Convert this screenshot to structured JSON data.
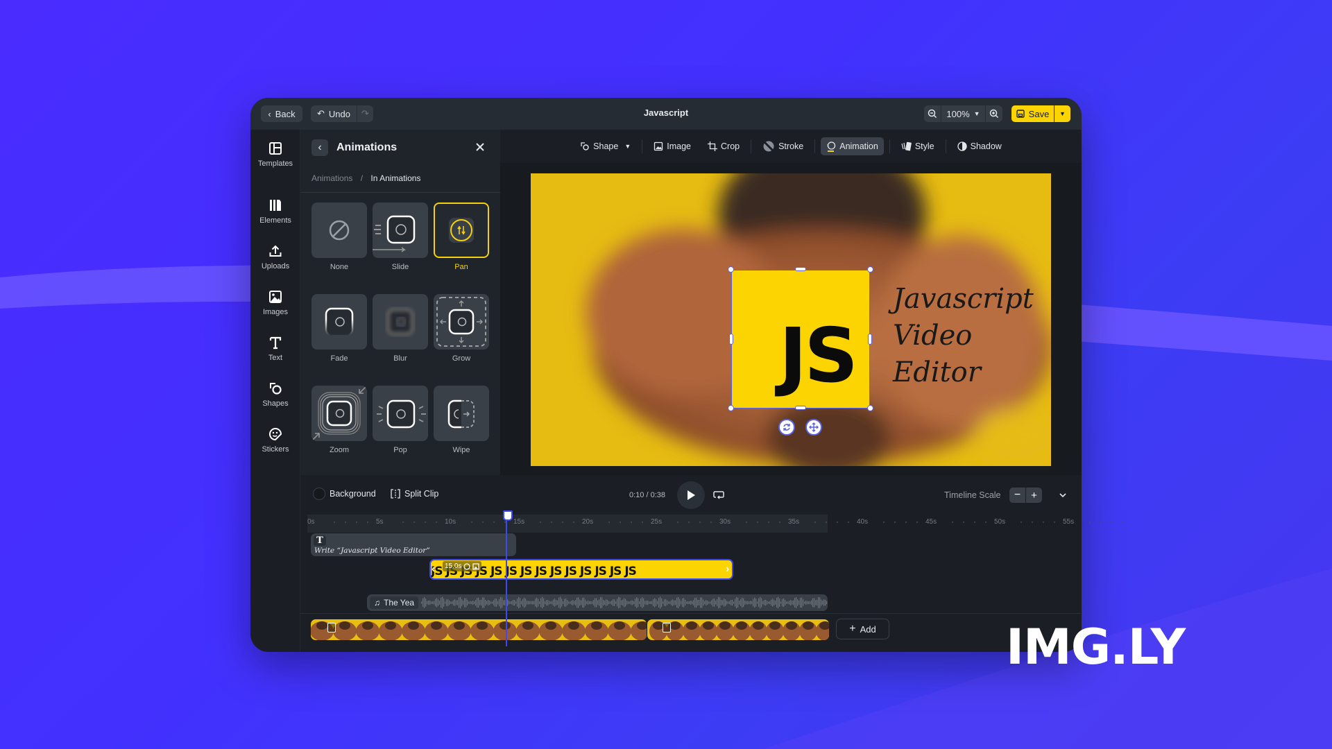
{
  "app": {
    "title": "Javascript",
    "back_label": "Back",
    "undo_label": "Undo",
    "zoom_level": "100%",
    "save_label": "Save"
  },
  "sidenav": [
    {
      "label": "Templates",
      "icon": "templates-icon"
    },
    {
      "label": "Elements",
      "icon": "elements-icon"
    },
    {
      "label": "Uploads",
      "icon": "upload-icon"
    },
    {
      "label": "Images",
      "icon": "image-icon"
    },
    {
      "label": "Text",
      "icon": "text-icon"
    },
    {
      "label": "Shapes",
      "icon": "shapes-icon"
    },
    {
      "label": "Stickers",
      "icon": "sticker-icon"
    }
  ],
  "panel": {
    "title": "Animations",
    "breadcrumb_root": "Animations",
    "breadcrumb_sep": "/",
    "breadcrumb_current": "In Animations",
    "animations": [
      {
        "label": "None",
        "selected": false
      },
      {
        "label": "Slide",
        "selected": false
      },
      {
        "label": "Pan",
        "selected": true
      },
      {
        "label": "Fade",
        "selected": false
      },
      {
        "label": "Blur",
        "selected": false
      },
      {
        "label": "Grow",
        "selected": false
      },
      {
        "label": "Zoom",
        "selected": false
      },
      {
        "label": "Pop",
        "selected": false
      },
      {
        "label": "Wipe",
        "selected": false
      }
    ]
  },
  "toolbar": {
    "items": [
      "Shape",
      "Image",
      "Crop",
      "Stroke",
      "Animation",
      "Style",
      "Shadow"
    ],
    "active": "Animation"
  },
  "canvas": {
    "logo_text": "JS",
    "caption_lines": [
      "Javascript",
      "Video",
      "Editor"
    ]
  },
  "timeline": {
    "background_label": "Background",
    "split_label": "Split Clip",
    "time_current": "0:10",
    "time_sep": "/",
    "time_total": "0:38",
    "scale_label": "Timeline Scale",
    "ticks": [
      "0s",
      "5s",
      "10s",
      "15s",
      "20s",
      "25s",
      "30s",
      "35s",
      "40s",
      "45s",
      "50s",
      "55s"
    ],
    "text_clip_label": "Write “Javascript Video Editor”",
    "logo_clip_duration": "15.0s",
    "logo_clip_tile": "JS",
    "audio_clip_label": "The Yea",
    "add_label": "Add"
  },
  "brand": {
    "watermark": "IMG.LY",
    "accent": "#f5d10b",
    "selection": "#5b62e0",
    "background": "#4330ff"
  }
}
